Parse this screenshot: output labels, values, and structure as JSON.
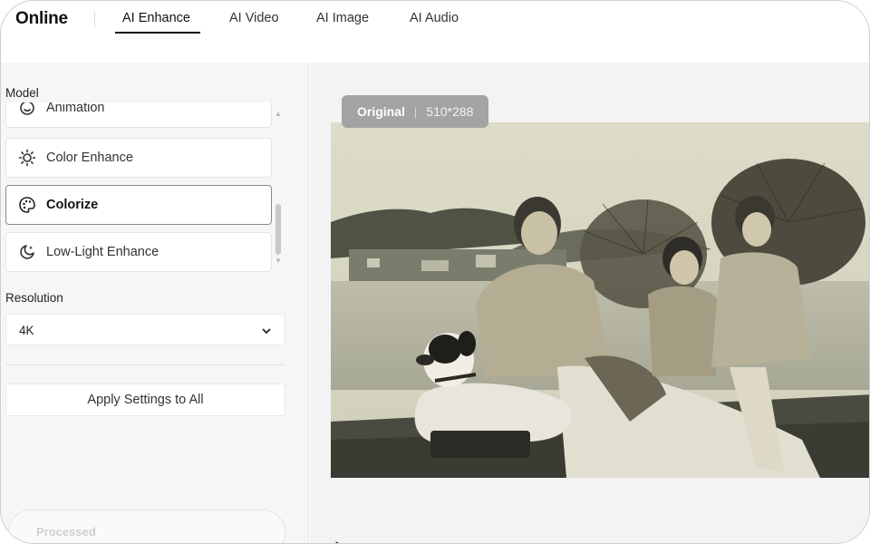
{
  "brand": "Online",
  "nav": {
    "tabs": [
      {
        "label": "AI Enhance",
        "active": true
      },
      {
        "label": "AI Video",
        "active": false
      },
      {
        "label": "AI Image",
        "active": false
      },
      {
        "label": "AI Audio",
        "active": false
      }
    ]
  },
  "sidebar": {
    "model_label": "Model",
    "models": [
      {
        "label": "Animation",
        "icon": "smile-icon",
        "selected": false
      },
      {
        "label": "Color Enhance",
        "icon": "sun-icon",
        "selected": false
      },
      {
        "label": "Colorize",
        "icon": "palette-icon",
        "selected": true
      },
      {
        "label": "Low-Light Enhance",
        "icon": "moon-sparkle-icon",
        "selected": false
      }
    ],
    "resolution_label": "Resolution",
    "resolution_value": "4K",
    "apply_button": "Apply Settings to All",
    "processed_label": "Processed"
  },
  "preview": {
    "badge_label": "Original",
    "badge_separator": "|",
    "badge_size": "510*288"
  },
  "colors": {
    "photo_sky": "#d9d9c4",
    "photo_water": "#b7b7a4",
    "badge_bg": "#a3a3a3",
    "selected_border": "#8a8a8a"
  }
}
